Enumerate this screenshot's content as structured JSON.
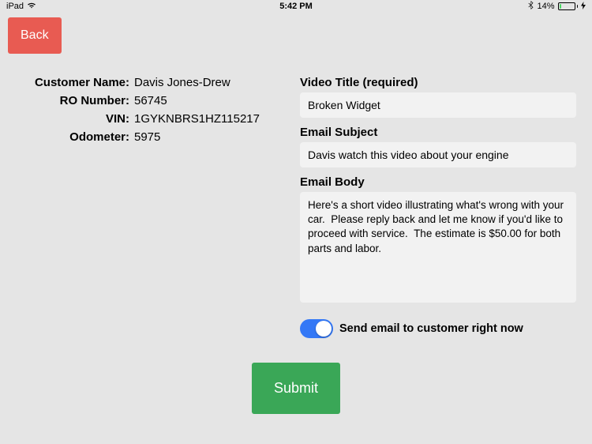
{
  "status_bar": {
    "device": "iPad",
    "time": "5:42 PM",
    "battery_percent": "14%"
  },
  "back_button": "Back",
  "customer": {
    "name_label": "Customer Name:",
    "name_value": "Davis Jones-Drew",
    "ro_label": "RO Number:",
    "ro_value": "56745",
    "vin_label": "VIN:",
    "vin_value": "1GYKNBRS1HZ115217",
    "odometer_label": "Odometer:",
    "odometer_value": "5975"
  },
  "form": {
    "video_title_label": "Video Title (required)",
    "video_title_value": "Broken Widget",
    "email_subject_label": "Email Subject",
    "email_subject_value": "Davis watch this video about your engine",
    "email_body_label": "Email Body",
    "email_body_value": "Here's a short video illustrating what's wrong with your car.  Please reply back and let me know if you'd like to proceed with service.  The estimate is $50.00 for both parts and labor.",
    "toggle_label": "Send email to customer right now",
    "toggle_on": true
  },
  "submit_button": "Submit"
}
